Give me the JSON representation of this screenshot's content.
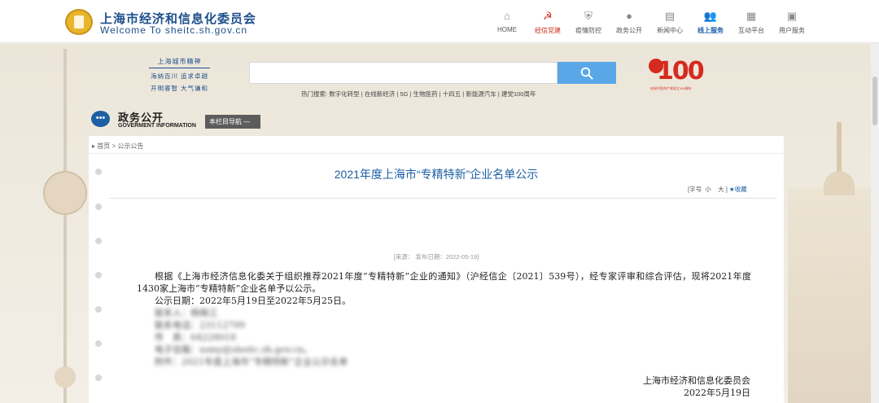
{
  "header": {
    "site_name_cn": "上海市经济和信息化委员会",
    "site_name_en": "Welcome  To  sheitc.sh.gov.cn",
    "nav": [
      {
        "label": "HOME",
        "icon": "home-icon",
        "glyph": "⌂"
      },
      {
        "label": "经信党建",
        "icon": "party-emblem-icon",
        "glyph": "☭"
      },
      {
        "label": "疫情防控",
        "icon": "shield-icon",
        "glyph": "⛨"
      },
      {
        "label": "政务公开",
        "icon": "chat-icon",
        "glyph": "●"
      },
      {
        "label": "新闻中心",
        "icon": "book-icon",
        "glyph": "▤"
      },
      {
        "label": "线上服务",
        "icon": "users-icon",
        "glyph": "👥"
      },
      {
        "label": "互动平台",
        "icon": "grid-icon",
        "glyph": "▦"
      },
      {
        "label": "用户服务",
        "icon": "building-icon",
        "glyph": "▣"
      }
    ]
  },
  "slogan": {
    "title": "上海城市精神",
    "line1": "海纳百川 追求卓越",
    "line2": "开明睿智 大气谦和"
  },
  "search": {
    "placeholder": "",
    "hot_label": "热门搜索:",
    "hot_terms": [
      "数字化转型",
      "在线新经济",
      "5G",
      "生物医药",
      "十四五",
      "新能源汽车",
      "建党100周年"
    ]
  },
  "centenary": {
    "number": "100",
    "caption": "庆祝中国共产党成立100周年"
  },
  "section": {
    "title_cn": "政务公开",
    "title_en": "GOVERMENT INFORMATION",
    "column_nav": "本栏目导航 —"
  },
  "breadcrumb": {
    "home": "首页",
    "separator": ">",
    "current": "公示公告"
  },
  "article": {
    "title": "2021年度上海市“专精特新”企业名单公示",
    "font_tools": {
      "label": "[字号",
      "small": "小",
      "large": "大",
      "close": "]",
      "favorite": "★收藏"
    },
    "meta": "[来源：   发布日期：2022-05-19]",
    "paragraph1": "根据《上海市经济信息化委关于组织推荐2021年度“专精特新”企业的通知》（沪经信企〔2021〕539号），经专家评审和综合评估，现将2021年度1430家上海市“专精特新”企业名单予以公示。",
    "paragraph2": "公示日期：2022年5月19日至2022年5月25日。",
    "blurred_lines": [
      "联系人：杨晓江",
      "联系电话：23112799",
      "传　真：64228018",
      "电子信箱：xsmy@sheitc.sh.gov.cn。",
      "附件：2021年度上海市“专精特新”企业公示名单"
    ],
    "signature_org": "上海市经济和信息化委员会",
    "signature_date": "2022年5月19日"
  },
  "colors": {
    "brand_blue": "#1d4f8c",
    "link_blue": "#1d5fa3",
    "party_red": "#d02c1e",
    "search_blue": "#5aa7e8"
  }
}
